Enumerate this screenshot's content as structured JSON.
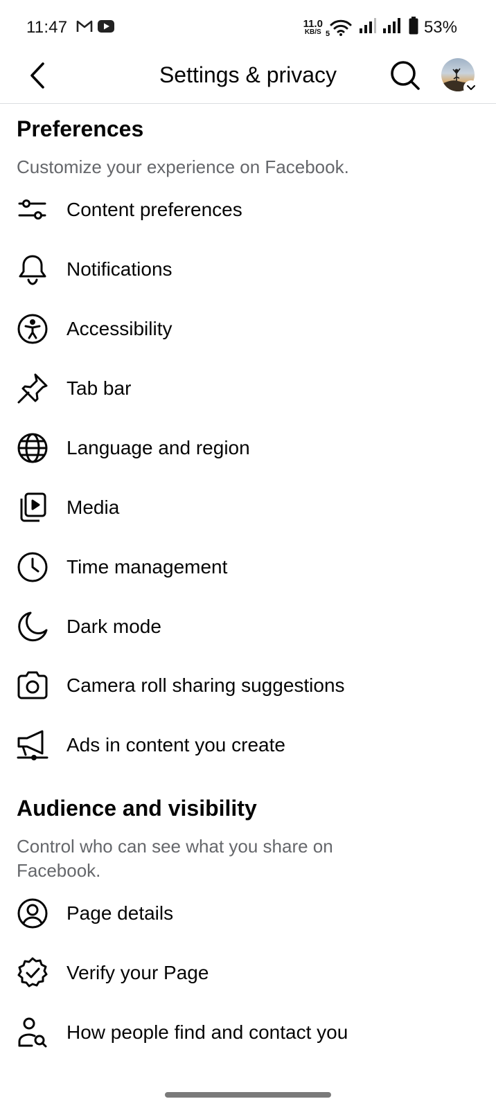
{
  "status_bar": {
    "time": "11:47",
    "left_icons": [
      "gmail-icon",
      "youtube-icon"
    ],
    "net_speed_value": "11.0",
    "net_speed_unit": "KB/S",
    "wifi_label": "5",
    "battery_percent": "53%"
  },
  "header": {
    "title": "Settings & privacy",
    "back_icon": "chevron-left-icon",
    "search_icon": "search-icon"
  },
  "preferences": {
    "title": "Preferences",
    "subtitle": "Customize your experience on Facebook.",
    "items": [
      {
        "label": "Content preferences",
        "icon": "sliders-icon"
      },
      {
        "label": "Notifications",
        "icon": "bell-icon"
      },
      {
        "label": "Accessibility",
        "icon": "accessibility-icon"
      },
      {
        "label": "Tab bar",
        "icon": "pin-icon"
      },
      {
        "label": "Language and region",
        "icon": "globe-icon"
      },
      {
        "label": "Media",
        "icon": "media-icon"
      },
      {
        "label": "Time management",
        "icon": "clock-icon"
      },
      {
        "label": "Dark mode",
        "icon": "moon-icon"
      },
      {
        "label": "Camera roll sharing suggestions",
        "icon": "camera-icon"
      },
      {
        "label": "Ads in content you create",
        "icon": "megaphone-icon"
      }
    ]
  },
  "audience": {
    "title": "Audience and visibility",
    "subtitle": "Control who can see what you share on Facebook.",
    "items": [
      {
        "label": "Page details",
        "icon": "profile-circle-icon"
      },
      {
        "label": "Verify your Page",
        "icon": "verified-badge-icon"
      },
      {
        "label": "How people find and contact you",
        "icon": "person-search-icon"
      }
    ]
  }
}
